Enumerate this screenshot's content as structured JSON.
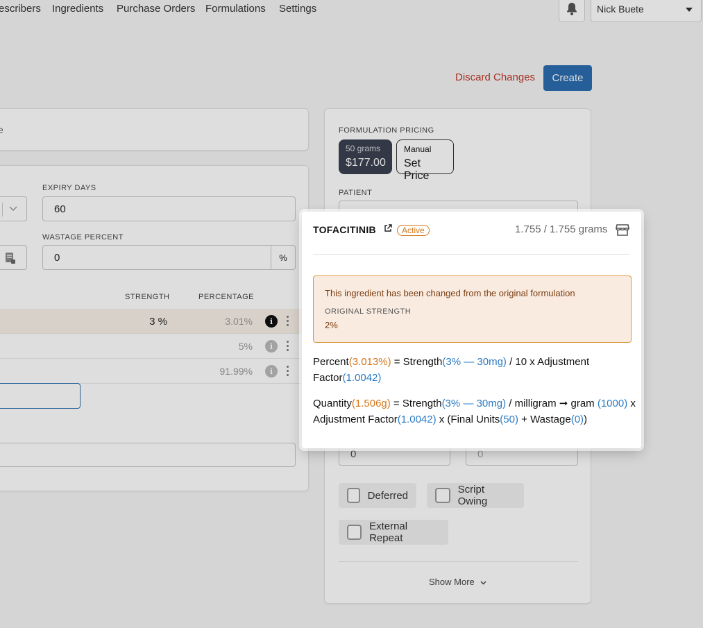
{
  "nav": {
    "items": [
      "escribers",
      "Ingredients",
      "Purchase Orders",
      "Formulations",
      "Settings"
    ],
    "user_name": "Nick Buete"
  },
  "actions": {
    "discard_label": "Discard Changes",
    "create_label": "Create"
  },
  "left_panel": {
    "top_card_text": "e",
    "expiry_days_label": "EXPIRY DAYS",
    "expiry_days_value": "60",
    "wastage_percent_label": "WASTAGE PERCENT",
    "wastage_percent_value": "0",
    "wastage_suffix": "%",
    "table_headers": {
      "strength": "STRENGTH",
      "percentage": "PERCENTAGE"
    },
    "rows": [
      {
        "strength": "3 %",
        "percentage": "3.01%",
        "highlighted": true
      },
      {
        "strength": "",
        "percentage": "5%",
        "highlighted": false
      },
      {
        "strength": "",
        "percentage": "91.99%",
        "highlighted": false
      }
    ]
  },
  "right_panel": {
    "pricing_label": "FORMULATION PRICING",
    "price_tiles": [
      {
        "line1": "50 grams",
        "line2": "$177.00",
        "selected": true
      },
      {
        "line1": "Manual",
        "line2": "Set Price",
        "selected": false
      }
    ],
    "patient_label": "PATIENT",
    "field_a_value": "0",
    "field_b_value": "0",
    "checkboxes": {
      "deferred": "Deferred",
      "script_owing": "Script Owing",
      "external_repeat": "External Repeat"
    },
    "show_more_label": "Show More"
  },
  "popup": {
    "ingredient_name": "TOFACITINIB",
    "status_badge": "Active",
    "grams_text": "1.755 / 1.755 grams",
    "warning_message": "This ingredient has been changed from the original formulation",
    "original_strength_label": "ORIGINAL STRENGTH",
    "original_strength_value": "2%",
    "percent_formula": {
      "label": "Percent",
      "value": "(3.013%)",
      "eq": " = Strength",
      "strength": "(3% — 30mg)",
      "mid": " / 10 x Adjustment Factor",
      "factor": "(1.0042)"
    },
    "quantity_formula": {
      "label": "Quantity",
      "value": "(1.506g)",
      "eq": " = Strength",
      "strength": "(3% — 30mg)",
      "mid1": " / milligram ➞ gram ",
      "conv": "(1000)",
      "mid2": " x Adjustment Factor",
      "factor": "(1.0042)",
      "mid3": " x (Final Units",
      "units": "(50)",
      "mid4": " + Wastage",
      "wastage": "(0)",
      "end": ")"
    }
  },
  "colors": {
    "accent": "#2b6cb0",
    "danger": "#c0392b",
    "warning_text": "#d4761c",
    "formula_blue": "#2b7bc4"
  }
}
